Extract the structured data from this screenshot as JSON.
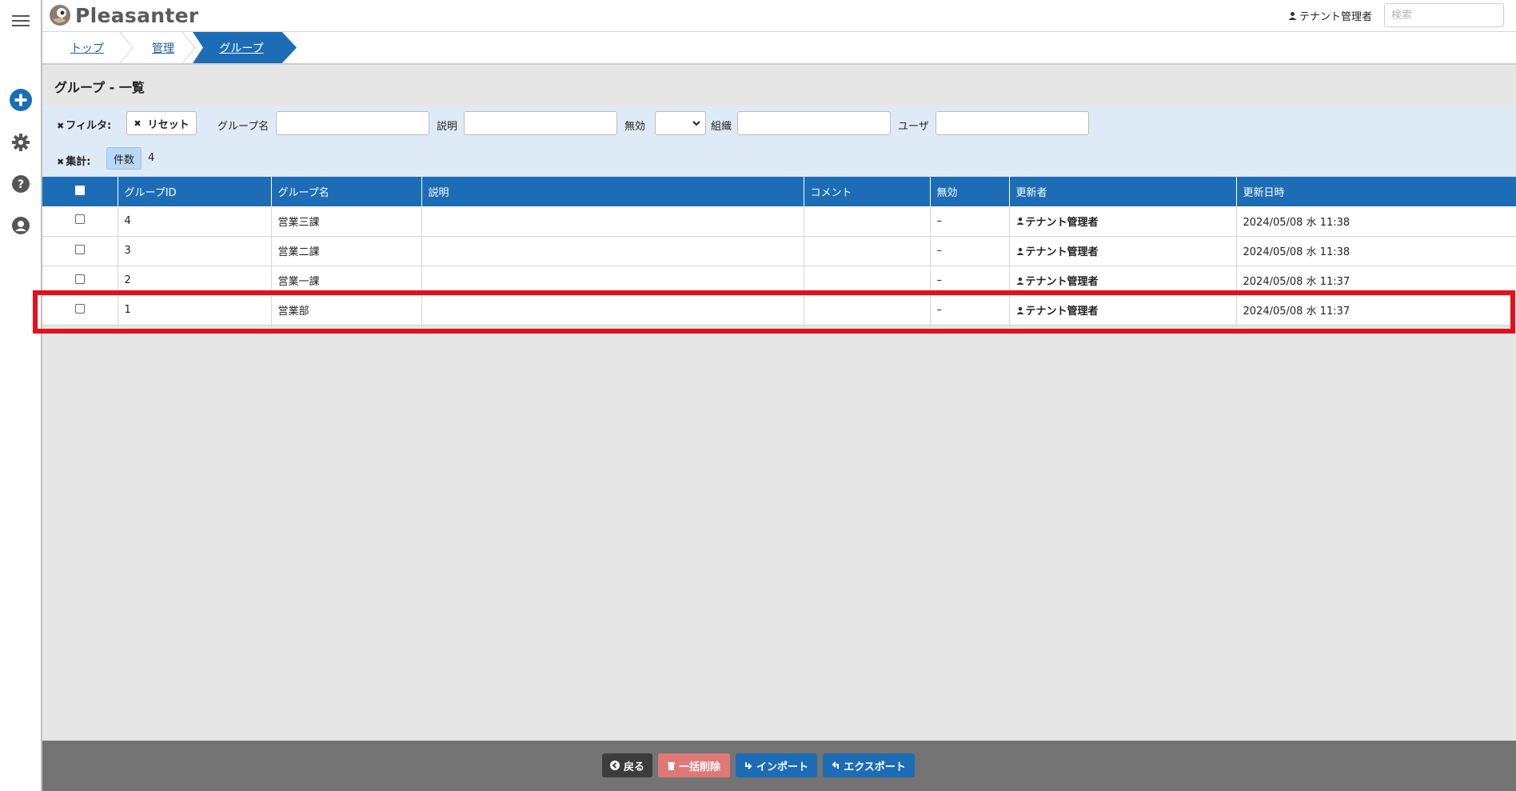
{
  "app": {
    "name": "Pleasanter"
  },
  "header": {
    "user_name": "テナント管理者",
    "search_placeholder": "検索"
  },
  "breadcrumb": [
    {
      "label": "トップ"
    },
    {
      "label": "管理"
    },
    {
      "label": "グループ"
    }
  ],
  "page": {
    "title": "グループ - 一覧"
  },
  "filters": {
    "filter_label": "フィルタ:",
    "reset_label": "リセット",
    "group_name_label": "グループ名",
    "description_label": "説明",
    "disabled_label": "無効",
    "organization_label": "組織",
    "user_label": "ユーザ",
    "aggregate_label": "集計:",
    "count_chip": "件数",
    "count_value": "4"
  },
  "table": {
    "columns": [
      "グループID",
      "グループ名",
      "説明",
      "コメント",
      "無効",
      "更新者",
      "更新日時"
    ],
    "rows": [
      {
        "id": "4",
        "name": "営業三課",
        "description": "",
        "comment": "",
        "disabled": "–",
        "updater": "テナント管理者",
        "updated": "2024/05/08 水 11:38"
      },
      {
        "id": "3",
        "name": "営業二課",
        "description": "",
        "comment": "",
        "disabled": "–",
        "updater": "テナント管理者",
        "updated": "2024/05/08 水 11:38"
      },
      {
        "id": "2",
        "name": "営業一課",
        "description": "",
        "comment": "",
        "disabled": "–",
        "updater": "テナント管理者",
        "updated": "2024/05/08 水 11:37"
      },
      {
        "id": "1",
        "name": "営業部",
        "description": "",
        "comment": "",
        "disabled": "–",
        "updater": "テナント管理者",
        "updated": "2024/05/08 水 11:37"
      }
    ]
  },
  "bottom": {
    "back_label": "戻る",
    "bulk_delete_label": "一括削除",
    "import_label": "インポート",
    "export_label": "エクスポート"
  },
  "colors": {
    "primary": "#1c6db5",
    "highlight": "#e3101e",
    "delete": "#e07878",
    "dark": "#3c3c3c"
  }
}
